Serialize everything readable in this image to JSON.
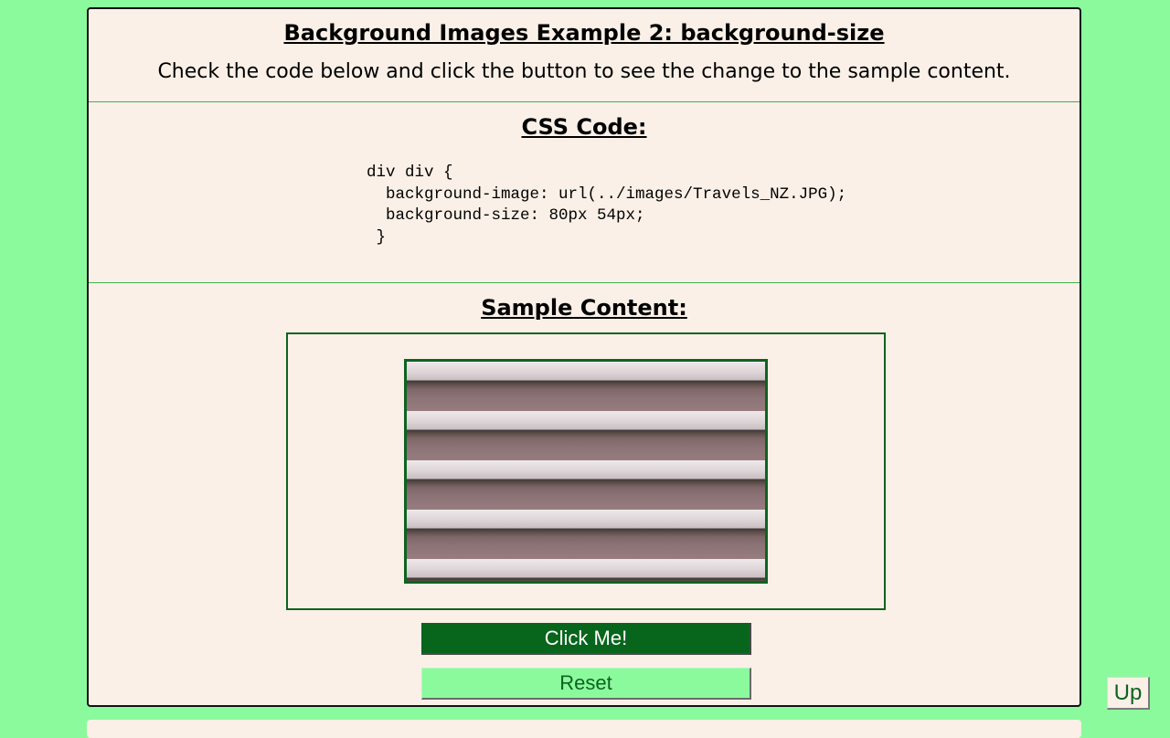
{
  "header": {
    "title": "Background Images Example 2: background-size",
    "intro": "Check the code below and click the button to see the change to the sample content."
  },
  "css_section": {
    "heading": "CSS Code:",
    "code": "div div {\n  background-image: url(../images/Travels_NZ.JPG);\n  background-size: 80px 54px;\n }"
  },
  "sample_section": {
    "heading": "Sample Content:"
  },
  "buttons": {
    "click_me": "Click Me!",
    "reset": "Reset",
    "up": "Up"
  },
  "colors": {
    "page_background": "#8bfa9d",
    "panel_background": "#faf0e7",
    "accent_dark_green": "#08651c",
    "divider_green": "#3fb153"
  }
}
